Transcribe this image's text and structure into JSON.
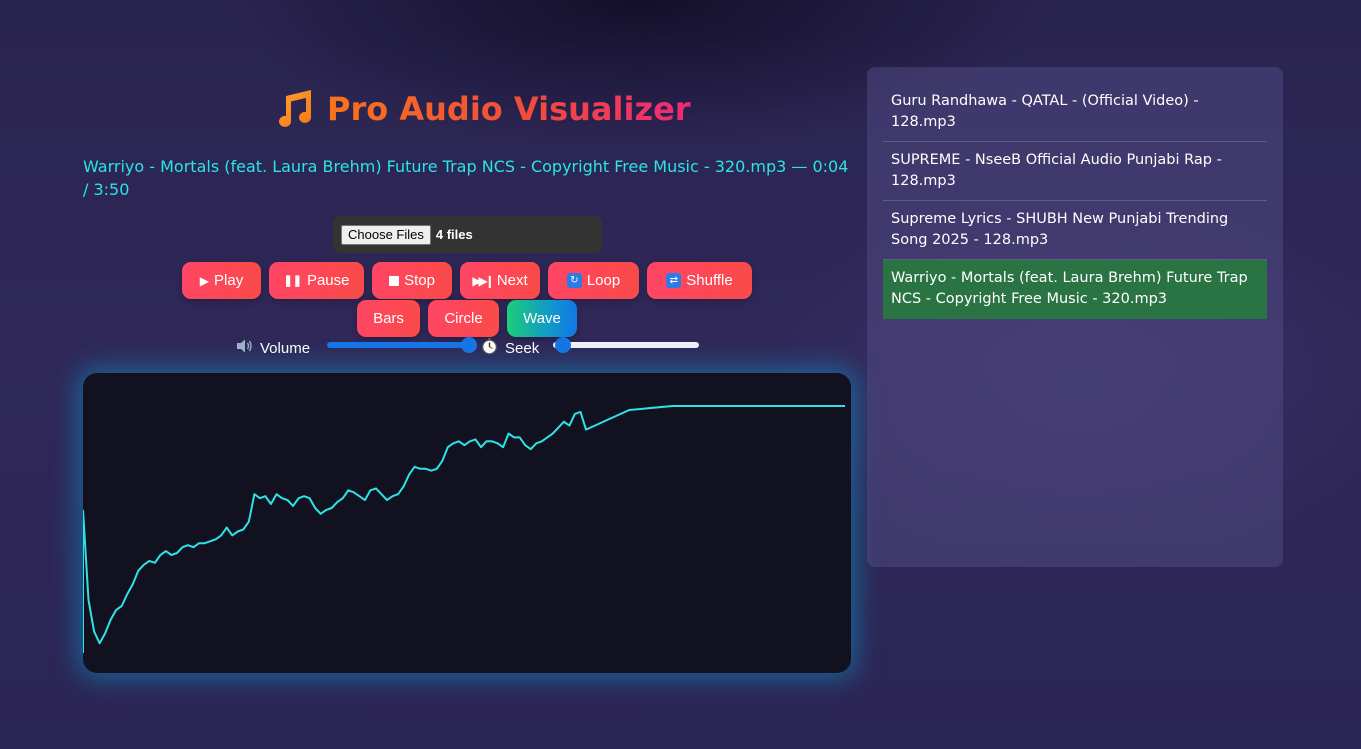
{
  "app": {
    "title": "Pro Audio Visualizer",
    "icon": "music-notes-icon"
  },
  "now_playing": {
    "text": "Warriyo - Mortals (feat. Laura Brehm) Future Trap NCS - Copyright Free Music - 320.mp3 — 0:04 / 3:50"
  },
  "file_input": {
    "button_label": "Choose Files",
    "status": "4 files"
  },
  "controls": {
    "play": "Play",
    "pause": "Pause",
    "stop": "Stop",
    "next": "Next",
    "loop": "Loop",
    "shuffle": "Shuffle",
    "bars": "Bars",
    "circle": "Circle",
    "wave": "Wave",
    "active_mode": "Wave"
  },
  "sliders": {
    "volume_label": "Volume",
    "volume_value": 1.0,
    "seek_label": "Seek",
    "seek_value": 0.017
  },
  "playlist": {
    "items": [
      "Guru Randhawa - QATAL - (Official Video) - 128.mp3",
      "SUPREME - NseeB Official Audio Punjabi Rap - 128.mp3",
      "Supreme Lyrics - SHUBH New Punjabi Trending Song 2025 - 128.mp3",
      "Warriyo - Mortals (feat. Laura Brehm) Future Trap NCS - Copyright Free Music - 320.mp3"
    ],
    "active_index": 3
  },
  "colors": {
    "accent_button": "#ff4664",
    "wave_line": "#2de3e6",
    "now_playing_text": "#2de3e6",
    "active_item": "#2a7443"
  },
  "waveform": [
    0.73,
    0.27,
    0.11,
    0.05,
    0.1,
    0.17,
    0.22,
    0.24,
    0.3,
    0.35,
    0.42,
    0.45,
    0.47,
    0.46,
    0.5,
    0.52,
    0.5,
    0.51,
    0.54,
    0.55,
    0.54,
    0.56,
    0.56,
    0.57,
    0.58,
    0.6,
    0.64,
    0.6,
    0.62,
    0.63,
    0.67,
    0.81,
    0.79,
    0.8,
    0.76,
    0.81,
    0.79,
    0.78,
    0.75,
    0.79,
    0.8,
    0.79,
    0.74,
    0.71,
    0.73,
    0.74,
    0.77,
    0.79,
    0.83,
    0.82,
    0.8,
    0.78,
    0.83,
    0.84,
    0.81,
    0.78,
    0.8,
    0.81,
    0.85,
    0.91,
    0.95,
    0.94,
    0.94,
    0.93,
    0.94,
    0.98,
    1.05,
    1.07,
    1.08,
    1.06,
    1.08,
    1.09,
    1.05,
    1.08,
    1.08,
    1.07,
    1.05,
    1.12,
    1.1,
    1.1,
    1.06,
    1.04,
    1.07,
    1.08,
    1.1,
    1.12,
    1.15,
    1.18,
    1.16,
    1.22,
    1.23,
    1.14,
    1.24,
    1.26,
    1.26,
    1.26,
    1.26,
    1.26
  ]
}
